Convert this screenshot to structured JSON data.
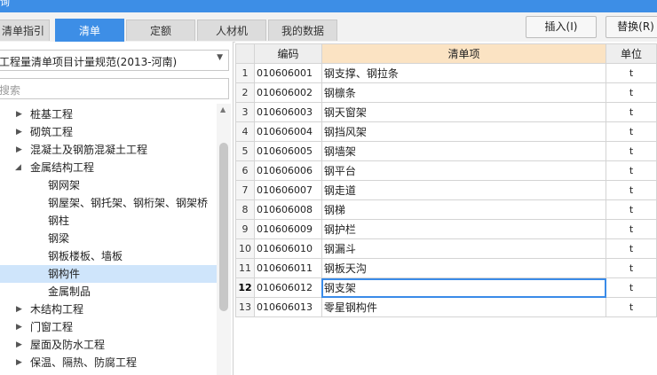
{
  "window": {
    "title_fragment": "询"
  },
  "tabs": [
    {
      "label": "清单指引",
      "active": false
    },
    {
      "label": "清单",
      "active": true
    },
    {
      "label": "定额",
      "active": false
    },
    {
      "label": "人材机",
      "active": false
    },
    {
      "label": "我的数据",
      "active": false
    }
  ],
  "toolbar": {
    "insert_label": "插入(I)",
    "replace_label": "替换(R)"
  },
  "left": {
    "spec_selected": "工程量清单项目计量规范(2013-河南)",
    "search_placeholder": "搜索",
    "tree": [
      {
        "label": "桩基工程",
        "level": 0,
        "expanded": false
      },
      {
        "label": "砌筑工程",
        "level": 0,
        "expanded": false
      },
      {
        "label": "混凝土及钢筋混凝土工程",
        "level": 0,
        "expanded": false
      },
      {
        "label": "金属结构工程",
        "level": 0,
        "expanded": true
      },
      {
        "label": "钢网架",
        "level": 1
      },
      {
        "label": "钢屋架、钢托架、钢桁架、钢架桥",
        "level": 1
      },
      {
        "label": "钢柱",
        "level": 1
      },
      {
        "label": "钢梁",
        "level": 1
      },
      {
        "label": "钢板楼板、墙板",
        "level": 1
      },
      {
        "label": "钢构件",
        "level": 1,
        "selected": true
      },
      {
        "label": "金属制品",
        "level": 1
      },
      {
        "label": "木结构工程",
        "level": 0,
        "expanded": false
      },
      {
        "label": "门窗工程",
        "level": 0,
        "expanded": false
      },
      {
        "label": "屋面及防水工程",
        "level": 0,
        "expanded": false
      },
      {
        "label": "保温、隔热、防腐工程",
        "level": 0,
        "expanded": false
      }
    ]
  },
  "table": {
    "headers": {
      "code": "编码",
      "item": "清单项",
      "unit": "单位"
    },
    "rows": [
      {
        "n": "1",
        "code": "010606001",
        "name": "钢支撑、钢拉条",
        "unit": "t"
      },
      {
        "n": "2",
        "code": "010606002",
        "name": "钢檩条",
        "unit": "t"
      },
      {
        "n": "3",
        "code": "010606003",
        "name": "钢天窗架",
        "unit": "t"
      },
      {
        "n": "4",
        "code": "010606004",
        "name": "钢挡风架",
        "unit": "t"
      },
      {
        "n": "5",
        "code": "010606005",
        "name": "钢墙架",
        "unit": "t"
      },
      {
        "n": "6",
        "code": "010606006",
        "name": "钢平台",
        "unit": "t"
      },
      {
        "n": "7",
        "code": "010606007",
        "name": "钢走道",
        "unit": "t"
      },
      {
        "n": "8",
        "code": "010606008",
        "name": "钢梯",
        "unit": "t"
      },
      {
        "n": "9",
        "code": "010606009",
        "name": "钢护栏",
        "unit": "t"
      },
      {
        "n": "10",
        "code": "010606010",
        "name": "钢漏斗",
        "unit": "t"
      },
      {
        "n": "11",
        "code": "010606011",
        "name": "钢板天沟",
        "unit": "t"
      },
      {
        "n": "12",
        "code": "010606012",
        "name": "钢支架",
        "unit": "t",
        "current": true
      },
      {
        "n": "13",
        "code": "010606013",
        "name": "零星钢构件",
        "unit": "t"
      }
    ]
  },
  "colors": {
    "accent": "#3d8ee6",
    "selection": "#cfe5fb",
    "header_highlight": "#fbe3c3"
  }
}
